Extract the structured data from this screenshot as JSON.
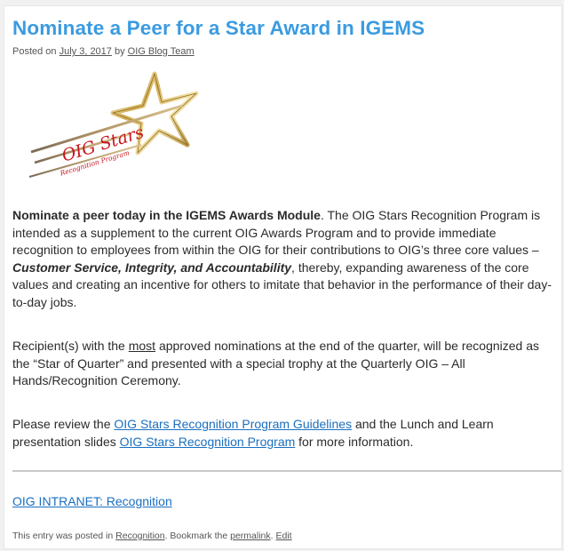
{
  "post": {
    "title": "Nominate a Peer for a Star Award in IGEMS",
    "meta": {
      "posted_on": "Posted on ",
      "date": "July 3, 2017",
      "by": " by ",
      "author": "OIG Blog Team"
    },
    "logo": {
      "text_main": "OIG Stars",
      "text_sub": "Recognition Program"
    },
    "paragraph1": {
      "lead_bold": "Nominate a peer today in the IGEMS Awards Module",
      "text_a": ".  The OIG Stars Recognition Program is intended as a supplement to the current OIG Awards Program and to provide immediate recognition to employees from within the OIG for their contributions to OIG’s three core values – ",
      "values_bold_italic": "Customer Service, Integrity, and Accountability",
      "text_b": ", thereby, expanding awareness of the core values and creating an incentive for others to imitate that behavior in the performance of their day-to-day jobs."
    },
    "paragraph2": {
      "text_a": "Recipient(s) with the ",
      "underlined": "most",
      "text_b": " approved nominations at the end of the quarter, will be recognized as the “Star of Quarter” and presented with a special trophy at the Quarterly OIG – All Hands/Recognition Ceremony."
    },
    "paragraph3": {
      "text_a": "Please review the ",
      "link_guidelines": "OIG Stars Recognition Program Guidelines",
      "text_b": " and the Lunch and Learn presentation slides ",
      "link_program": "OIG Stars Recognition Program",
      "text_c": " for more information."
    },
    "intranet_link": "OIG INTRANET: Recognition",
    "footer": {
      "text_a": "This entry was posted in ",
      "category": "Recognition",
      "text_b": ". Bookmark the ",
      "permalink": "permalink",
      "text_c": ". ",
      "edit": "Edit"
    }
  },
  "colors": {
    "title": "#3b9be0",
    "link": "#1a6fc0",
    "logo_red": "#c8141e",
    "star_gold": "#c9a54a"
  }
}
